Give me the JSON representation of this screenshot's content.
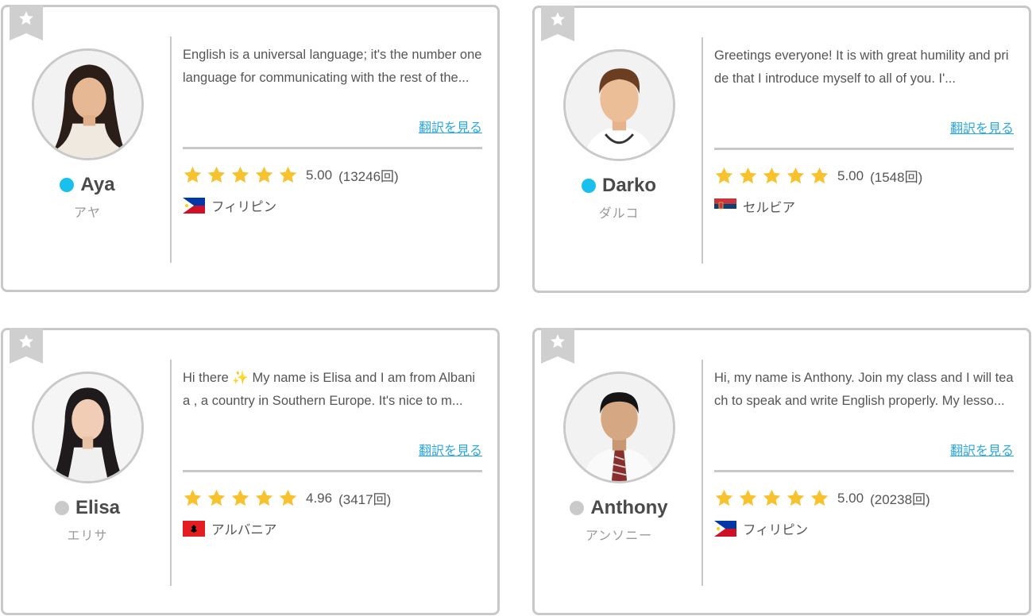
{
  "colors": {
    "online": "#19c0ee",
    "offline": "#cacaca",
    "star": "#f8c22e",
    "link": "#2aa6e0",
    "border": "#c8c8c8"
  },
  "translate_label": "翻訳を見る",
  "tutors": [
    {
      "name": "Aya",
      "kana": "アヤ",
      "status": "online",
      "intro": "English is a universal language; it's the number one language for communicating with the rest of the...",
      "rating": "5.00",
      "count": "(13246回)",
      "stars": 5,
      "country": "フィリピン",
      "flag_icon": "philippines-flag-icon",
      "avatar": "female-long-dark-hair"
    },
    {
      "name": "Darko",
      "kana": "ダルコ",
      "status": "online",
      "intro": "Greetings everyone! It is with great humility and pride that I introduce myself to all of you. I'...",
      "rating": "5.00",
      "count": "(1548回)",
      "stars": 5,
      "country": "セルビア",
      "flag_icon": "serbia-flag-icon",
      "avatar": "male-doctor-brown-hair"
    },
    {
      "name": "Elisa",
      "kana": "エリサ",
      "status": "offline",
      "intro": "Hi there ✨ My name is Elisa and I am from Albania , a country in Southern Europe. It's nice to m...",
      "rating": "4.96",
      "count": "(3417回)",
      "stars": 5,
      "country": "アルバニア",
      "flag_icon": "albania-flag-icon",
      "avatar": "female-long-black-hair"
    },
    {
      "name": "Anthony",
      "kana": "アンソニー",
      "status": "offline",
      "intro": "Hi, my name is Anthony. Join my class and I will teach to speak and write English properly. My lesso...",
      "rating": "5.00",
      "count": "(20238回)",
      "stars": 5,
      "country": "フィリピン",
      "flag_icon": "philippines-flag-icon",
      "avatar": "male-short-black-hair-tie"
    }
  ]
}
